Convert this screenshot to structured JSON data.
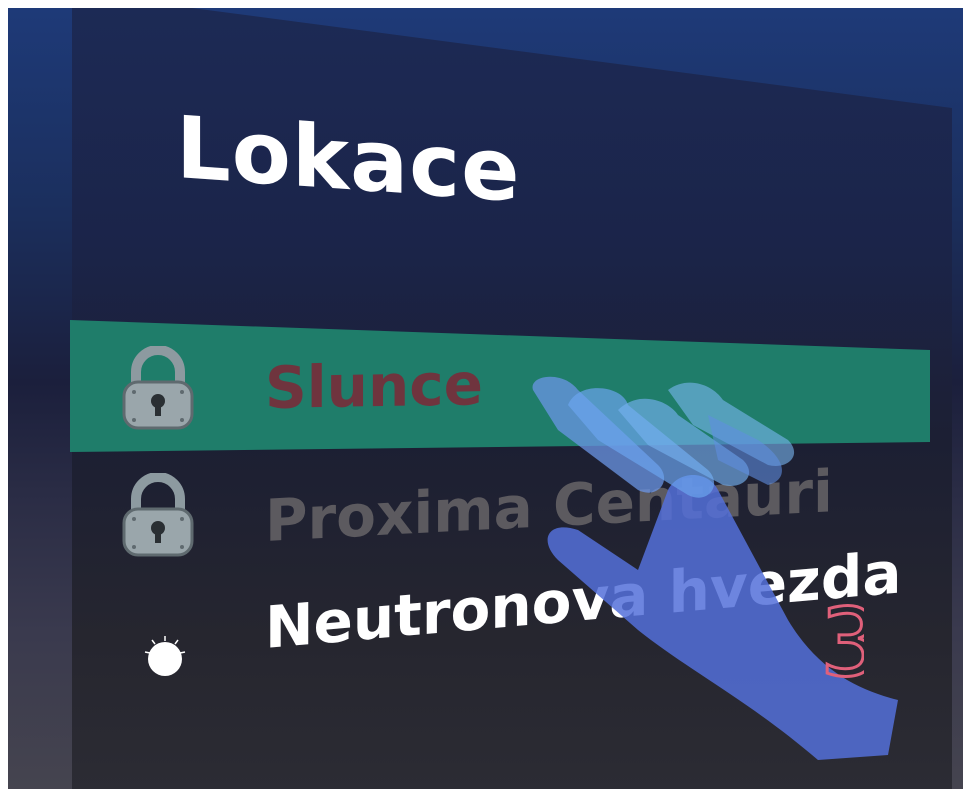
{
  "panel": {
    "title": "Lokace"
  },
  "locations": [
    {
      "label": "Slunce",
      "state": "locked",
      "selected": true,
      "icon": "padlock-icon"
    },
    {
      "label": "Proxima Centauri",
      "state": "locked",
      "selected": false,
      "icon": "padlock-icon"
    },
    {
      "label": "Neutronova hvezda",
      "state": "unlocked",
      "selected": false,
      "icon": "glowing-star-icon"
    }
  ],
  "cursor": {
    "icon": "hand-pointer-icon",
    "annotation": "3"
  },
  "colors": {
    "highlight": "#1f7d6a",
    "background_top": "#1e3a78",
    "background_bottom": "#45444f",
    "locked_text": "#5c5a5f",
    "locked_selected_text": "#6f343e",
    "active_text": "#ffffff",
    "hand": "#5470d9",
    "annotation": "#e0607a"
  }
}
